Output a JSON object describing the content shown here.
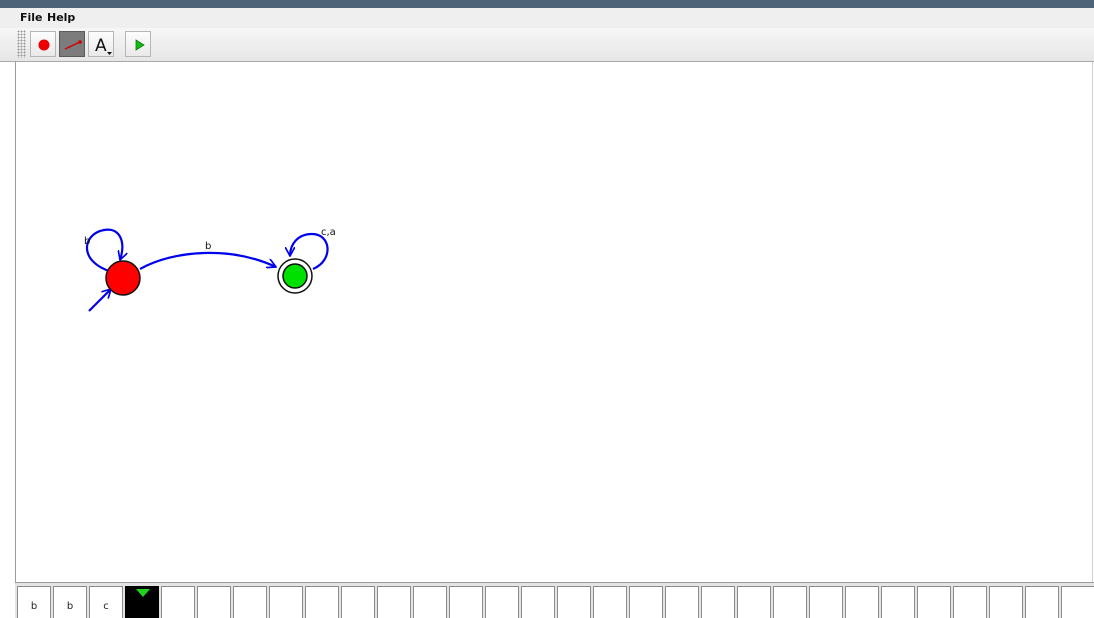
{
  "menu": {
    "file": "File",
    "help": "Help"
  },
  "toolbar": {
    "tools": [
      {
        "name": "state-tool",
        "icon": "red-circle-icon"
      },
      {
        "name": "transition-tool",
        "icon": "red-line-icon",
        "selected": true
      },
      {
        "name": "text-tool",
        "icon": "letter-a-icon",
        "glyph": "A"
      },
      {
        "name": "run-tool",
        "icon": "play-icon"
      }
    ]
  },
  "automaton": {
    "states": [
      {
        "id": "q0",
        "initial": true,
        "accepting": false,
        "fill": "#ff0000"
      },
      {
        "id": "q1",
        "initial": false,
        "accepting": true,
        "fill": "#00e000"
      }
    ],
    "transitions": [
      {
        "from": "q0",
        "to": "q0",
        "label": "b"
      },
      {
        "from": "q0",
        "to": "q1",
        "label": "b"
      },
      {
        "from": "q1",
        "to": "q1",
        "label": "c,a"
      }
    ],
    "edge_color": "#0000ee"
  },
  "tape": {
    "cells": [
      "b",
      "b",
      "c",
      "",
      "",
      "",
      "",
      "",
      "",
      "",
      "",
      "",
      "",
      "",
      "",
      "",
      "",
      "",
      "",
      "",
      "",
      "",
      "",
      "",
      "",
      "",
      "",
      "",
      "",
      ""
    ],
    "head_index": 3,
    "head_color": "#1ed41e"
  }
}
